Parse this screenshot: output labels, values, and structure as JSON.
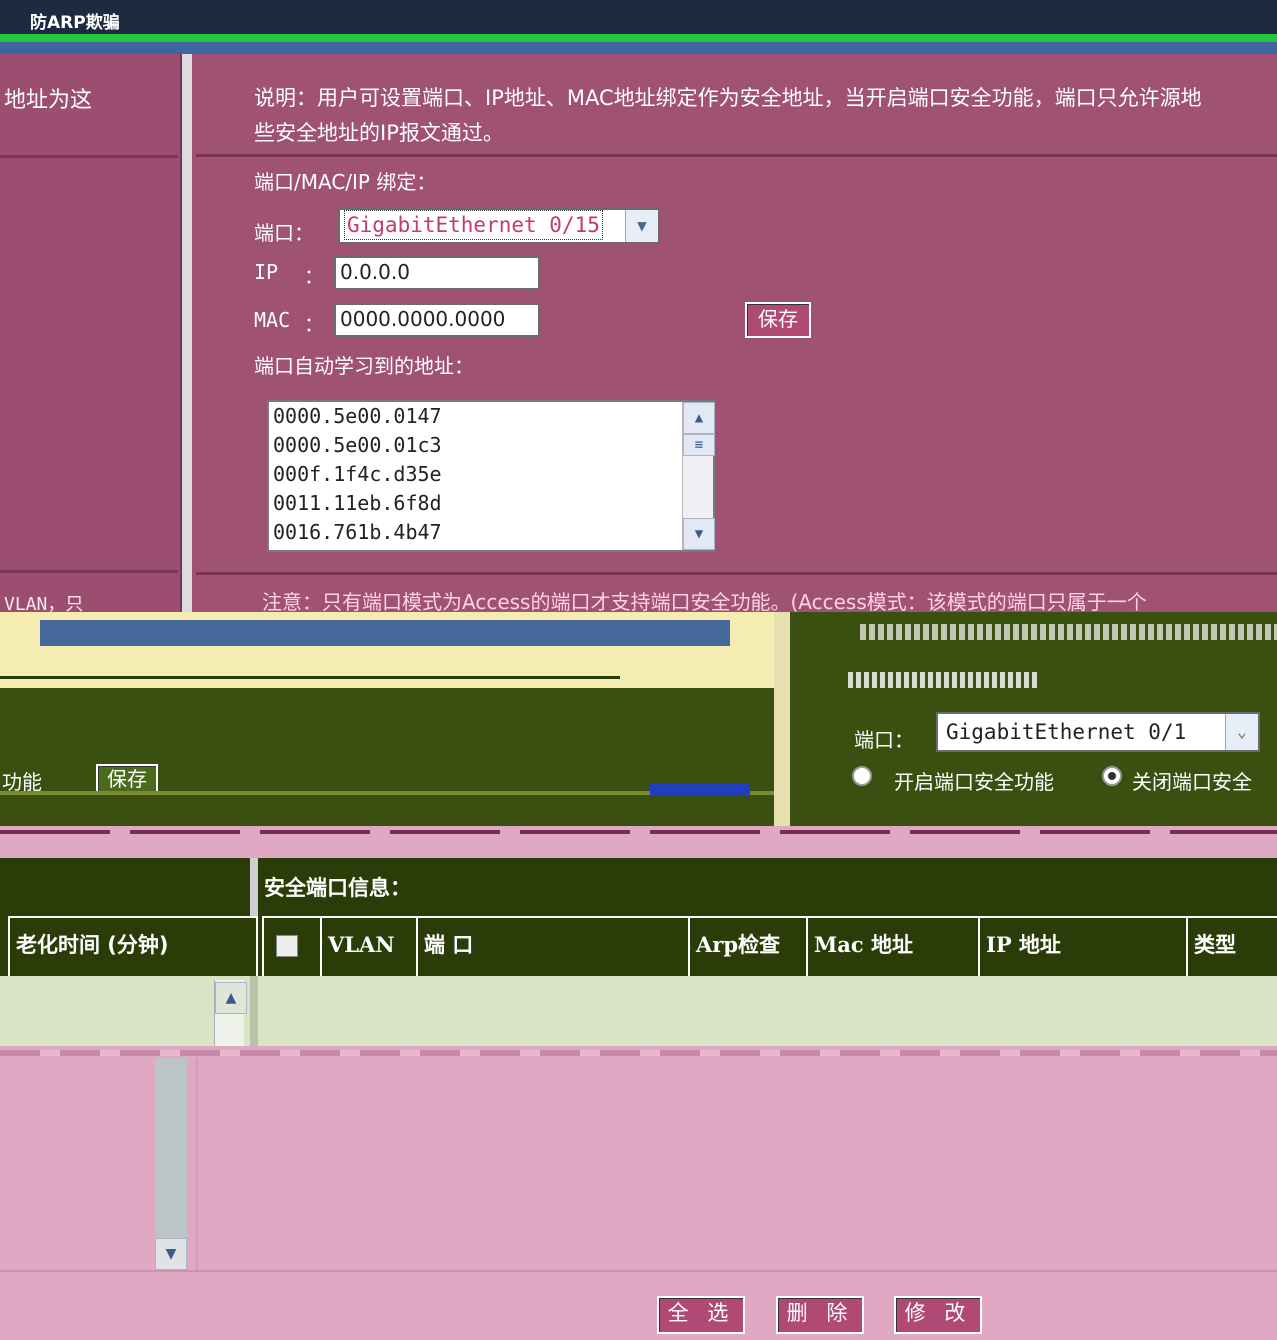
{
  "window_title": "防ARP欺骗",
  "top": {
    "left_text": "地址为这",
    "left_text2": "VLAN，只",
    "description_line1": "说明：用户可设置端口、IP地址、MAC地址绑定作为安全地址，当开启端口安全功能，端口只允许源地",
    "description_line2": "些安全地址的IP报文通过。",
    "binding_title": "端口/MAC/IP 绑定：",
    "port_label": "端口：",
    "port_value": "GigabitEthernet 0/15",
    "ip_label": "IP",
    "colon": "：",
    "ip_value": "0.0.0.0",
    "mac_label": "MAC",
    "mac_value": "0000.0000.0000",
    "save_label": "保存",
    "learned_title": "端口自动学习到的地址：",
    "learned_addresses": [
      "0000.5e00.0147",
      "0000.5e00.01c3",
      "000f.1f4c.d35e",
      "0011.11eb.6f8d",
      "0016.761b.4b47"
    ],
    "notice": "注意：只有端口模式为Access的端口才支持端口安全功能。(Access模式：该模式的端口只属于一个"
  },
  "middle": {
    "left_func": "功能",
    "left_save": "保存",
    "port_label": "端口：",
    "port_value": "GigabitEthernet 0/1",
    "enable_label": "开启端口安全功能",
    "disable_label": "关闭端口安全"
  },
  "bottom": {
    "left_header": "老化时间 (分钟)",
    "section_title": "安全端口信息：",
    "columns": [
      "VLAN",
      "端 口",
      "Arp检查",
      "Mac 地址",
      "IP 地址",
      "类型"
    ],
    "select_all": "全 选",
    "delete": "删 除",
    "modify": "修 改"
  }
}
